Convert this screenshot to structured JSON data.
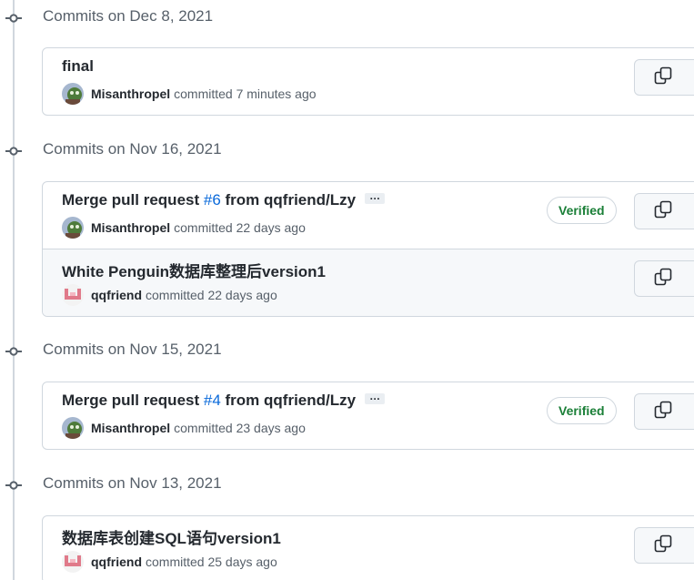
{
  "groups": [
    {
      "title": "Commits on Dec 8, 2021",
      "commits": [
        {
          "title": "final",
          "author": "Misanthropel",
          "action": "committed",
          "time": "7 minutes ago",
          "verified": "",
          "avatar": "frog-avatar"
        }
      ]
    },
    {
      "title": "Commits on Nov 16, 2021",
      "commits": [
        {
          "title_prefix": "Merge pull request ",
          "pr": "#6",
          "title_suffix": " from qqfriend/Lzy",
          "ellipsis": "…",
          "author": "Misanthropel",
          "action": "committed",
          "time": "22 days ago",
          "verified": "Verified",
          "avatar": "frog-avatar"
        },
        {
          "title": "White Penguin数据库整理后version1",
          "author": "qqfriend",
          "action": "committed",
          "time": "22 days ago",
          "verified": "",
          "avatar": "pink-pattern-avatar"
        }
      ]
    },
    {
      "title": "Commits on Nov 15, 2021",
      "commits": [
        {
          "title_prefix": "Merge pull request ",
          "pr": "#4",
          "title_suffix": " from qqfriend/Lzy",
          "ellipsis": "…",
          "author": "Misanthropel",
          "action": "committed",
          "time": "23 days ago",
          "verified": "Verified",
          "avatar": "frog-avatar"
        }
      ]
    },
    {
      "title": "Commits on Nov 13, 2021",
      "commits": [
        {
          "title": "数据库表创建SQL语句version1",
          "author": "qqfriend",
          "action": "committed",
          "time": "25 days ago",
          "verified": "",
          "avatar": "pink-pattern-avatar"
        }
      ]
    }
  ],
  "icons": {
    "commit_node": "git-commit-icon",
    "copy": "copy-icon"
  },
  "colors": {
    "link": "#0969da",
    "verified": "#1a7f37",
    "muted": "#57606a",
    "border": "#d0d7de"
  }
}
